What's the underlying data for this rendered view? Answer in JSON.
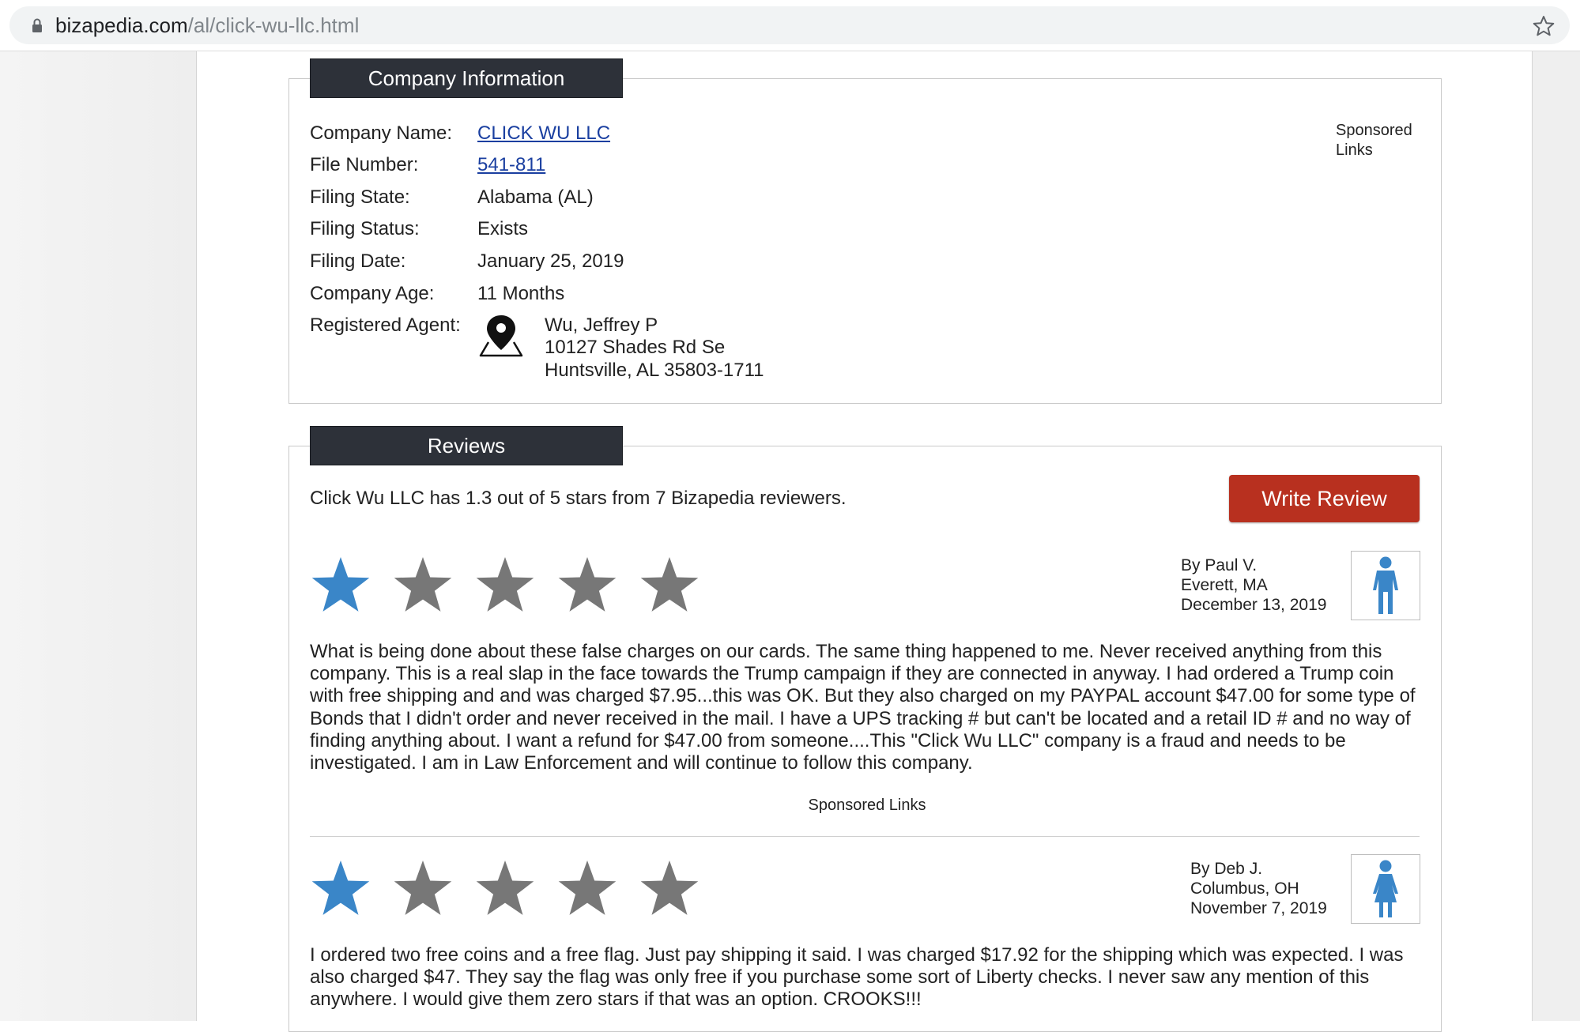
{
  "browser": {
    "url_domain": "bizapedia.com",
    "url_path": "/al/click-wu-llc.html",
    "icons": [
      "lock-icon",
      "bookmark-star-icon"
    ]
  },
  "company": {
    "header": "Company Information",
    "rows": [
      {
        "label": "Company Name:",
        "value": "CLICK WU LLC",
        "link": true
      },
      {
        "label": "File Number:",
        "value": "541-811",
        "link": true
      },
      {
        "label": "Filing State:",
        "value": "Alabama (AL)",
        "link": false
      },
      {
        "label": "Filing Status:",
        "value": "Exists",
        "link": false
      },
      {
        "label": "Filing Date:",
        "value": "January 25, 2019",
        "link": false
      },
      {
        "label": "Company Age:",
        "value": "11 Months",
        "link": false
      }
    ],
    "agent_label": "Registered Agent:",
    "agent_lines": [
      "Wu, Jeffrey P",
      "10127 Shades Rd Se",
      "Huntsville, AL 35803-1711"
    ],
    "sponsored": [
      "Sponsored",
      "Links"
    ]
  },
  "reviews": {
    "header": "Reviews",
    "summary": "Click Wu LLC has 1.3 out of 5 stars from 7 Bizapedia reviewers.",
    "write_button": "Write Review",
    "sponsored": "Sponsored Links",
    "items": [
      {
        "rating": 1,
        "max_rating": 5,
        "author": "By Paul V.",
        "location": "Everett, MA",
        "date": "December 13, 2019",
        "avatar": "male-avatar-icon",
        "text": "What is being done about these false charges on our cards. The same thing happened to me. Never received anything from this company. This is a real slap in the face towards the Trump campaign if they are connected in anyway. I had ordered a Trump coin with free shipping and and was charged $7.95...this was OK. But they also charged on my PAYPAL account $47.00 for some type of Bonds that I didn't order and never received in the mail. I have a UPS tracking # but can't be located and a retail ID # and no way of finding anything about. I want a refund for $47.00 from someone....This \"Click Wu LLC\" company is a fraud and needs to be investigated. I am in Law Enforcement and will continue to follow this company."
      },
      {
        "rating": 1,
        "max_rating": 5,
        "author": "By Deb J.",
        "location": "Columbus, OH",
        "date": "November 7, 2019",
        "avatar": "female-avatar-icon",
        "text": "I ordered two free coins and a free flag. Just pay shipping it said. I was charged $17.92 for the shipping which was expected. I was also charged $47. They say the flag was only free if you purchase some sort of Liberty checks. I never saw any mention of this anywhere. I would give them zero stars if that was an option. CROOKS!!!"
      }
    ]
  },
  "colors": {
    "header_bg": "#2d3139",
    "button_bg": "#b8301f",
    "star_filled": "#3a86c8",
    "star_empty": "#777777",
    "link": "#1a3fa0"
  }
}
